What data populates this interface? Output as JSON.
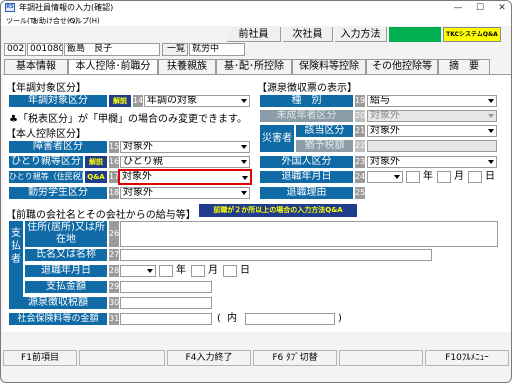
{
  "window": {
    "title": "年調社員情報の入力(確認)",
    "icon_text": "RS"
  },
  "menu": [
    "ツール(T)",
    "お助け合せ(Q)",
    "ヘルプ(H)"
  ],
  "toolbar": {
    "prev": "前社員",
    "next": "次社員",
    "input_method": "入力方法",
    "tkc": "TKCシステムQ&A"
  },
  "employee": {
    "code1": "002",
    "code2": "001080",
    "name": "飯島　良子",
    "list_btn": "一覧",
    "status": "就労中"
  },
  "tabs": [
    "基本情報",
    "本人控除･前職分",
    "扶養親族",
    "基･配･所控除",
    "保険料等控除",
    "その他控除等",
    "摘　要"
  ],
  "left": {
    "nenchou_title": "【年調対象区分】",
    "nenchou_label": "年調対象区分",
    "kaisetsu": "解説",
    "nenchou_num": "14",
    "nenchou_value": "年調の対象",
    "note": "♣「税表区分」が「甲欄」の場合のみ変更できます。",
    "koujo_title": "【本人控除区分】",
    "shougai_label": "障害者区分",
    "shougai_num": "15",
    "shougai_value": "対象外",
    "hitorioya_label": "ひとり親等区分",
    "hitorioya_num": "16",
    "hitorioya_value": "ひとり親",
    "hitorioya_ju_label": "ひとり親等（住民税）",
    "qa": "Q&A",
    "hitorioya_ju_num": "17",
    "hitorioya_ju_value": "対象外",
    "kinrou_label": "勤労学生区分",
    "kinrou_num": "18",
    "kinrou_value": "対象外"
  },
  "right": {
    "gensen_title": "【源泉徴収票の表示】",
    "shubetsu_label": "種　別",
    "shubetsu_num": "19",
    "shubetsu_value": "給与",
    "miseinen_label": "未成年者区分",
    "miseinen_num": "20",
    "miseinen_value": "対象外",
    "saigai_label": "災害者",
    "gaitou_label": "該当区分",
    "gaitou_num": "21",
    "gaitou_value": "対象外",
    "yuuyo_label": "猶予税額",
    "yuuyo_num": "22",
    "gaikoku_label": "外国人区分",
    "gaikoku_num": "23",
    "gaikoku_value": "対象外",
    "taishoku_date_label": "退職年月日",
    "taishoku_date_num": "24",
    "nen": "年",
    "tsuki": "月",
    "hi": "日",
    "taishoku_reason_label": "退職理由",
    "taishoku_reason_num": "25"
  },
  "prev_company": {
    "title": "【前職の会社名とその会社からの給与等】",
    "help_btn": "前職が２か所以上の場合の入力方法Q&A",
    "side_label": "支払者",
    "address_label": "住所(居所)又は所在地",
    "address_num": "26",
    "name_label": "氏名又は名称",
    "name_num": "27",
    "retire_label": "退職年月日",
    "retire_num": "28",
    "nen": "年",
    "tsuki": "月",
    "hi": "日",
    "pay_label": "支払金額",
    "pay_num": "29",
    "tax_label": "源泉徴収税額",
    "tax_num": "30",
    "social_label": "社会保険料等の金額",
    "social_num": "31",
    "paren_open": "(",
    "uchi": "内",
    "paren_close": ")"
  },
  "fkeys": {
    "f1": "F1前項目",
    "f4": "F4入力終了",
    "f6": "F6 ﾀﾌﾞ切替",
    "f10": "F10ﾌﾙﾒﾆｭｰ"
  },
  "colors": {
    "label_blue": "#0f6aa6",
    "number_gray": "#9b9b9b",
    "highlight_red": "#e00000",
    "tkc_yellow": "#ffff00",
    "green": "#00b050"
  }
}
